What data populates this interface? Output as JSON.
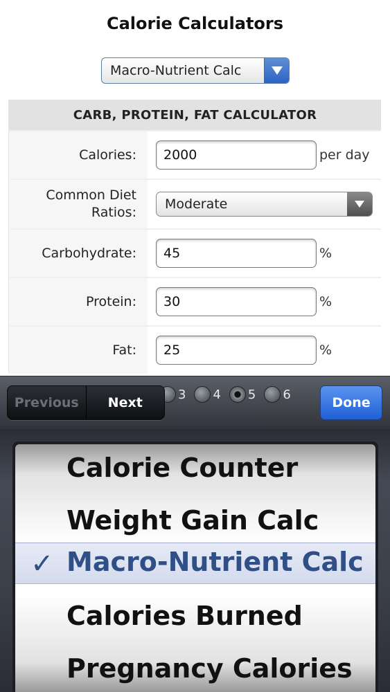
{
  "header": {
    "title": "Calorie Calculators"
  },
  "top_select": {
    "value": "Macro-Nutrient Calc"
  },
  "form": {
    "section_title": "CARB, PROTEIN, FAT CALCULATOR",
    "calories": {
      "label": "Calories:",
      "value": "2000",
      "suffix": "per day"
    },
    "diet": {
      "label": "Common Diet Ratios:",
      "value": "Moderate"
    },
    "carb": {
      "label": "Carbohydrate:",
      "value": "45",
      "suffix": "%"
    },
    "protein": {
      "label": "Protein:",
      "value": "30",
      "suffix": "%"
    },
    "fat": {
      "label": "Fat:",
      "value": "25",
      "suffix": "%"
    }
  },
  "toolbar": {
    "previous": "Previous",
    "next": "Next",
    "done": "Done",
    "radios": [
      {
        "label": "3",
        "selected": false
      },
      {
        "label": "4",
        "selected": false
      },
      {
        "label": "5",
        "selected": true
      },
      {
        "label": "6",
        "selected": false
      }
    ]
  },
  "picker": {
    "options": [
      "Calorie Counter",
      "Weight Gain Calc",
      "Macro-Nutrient Calc",
      "Calories Burned",
      "Pregnancy Calories"
    ],
    "selected_index": 2,
    "check": "✓"
  },
  "colors": {
    "accent_blue": "#1f5fd6",
    "selected_text": "#2f4f86"
  }
}
